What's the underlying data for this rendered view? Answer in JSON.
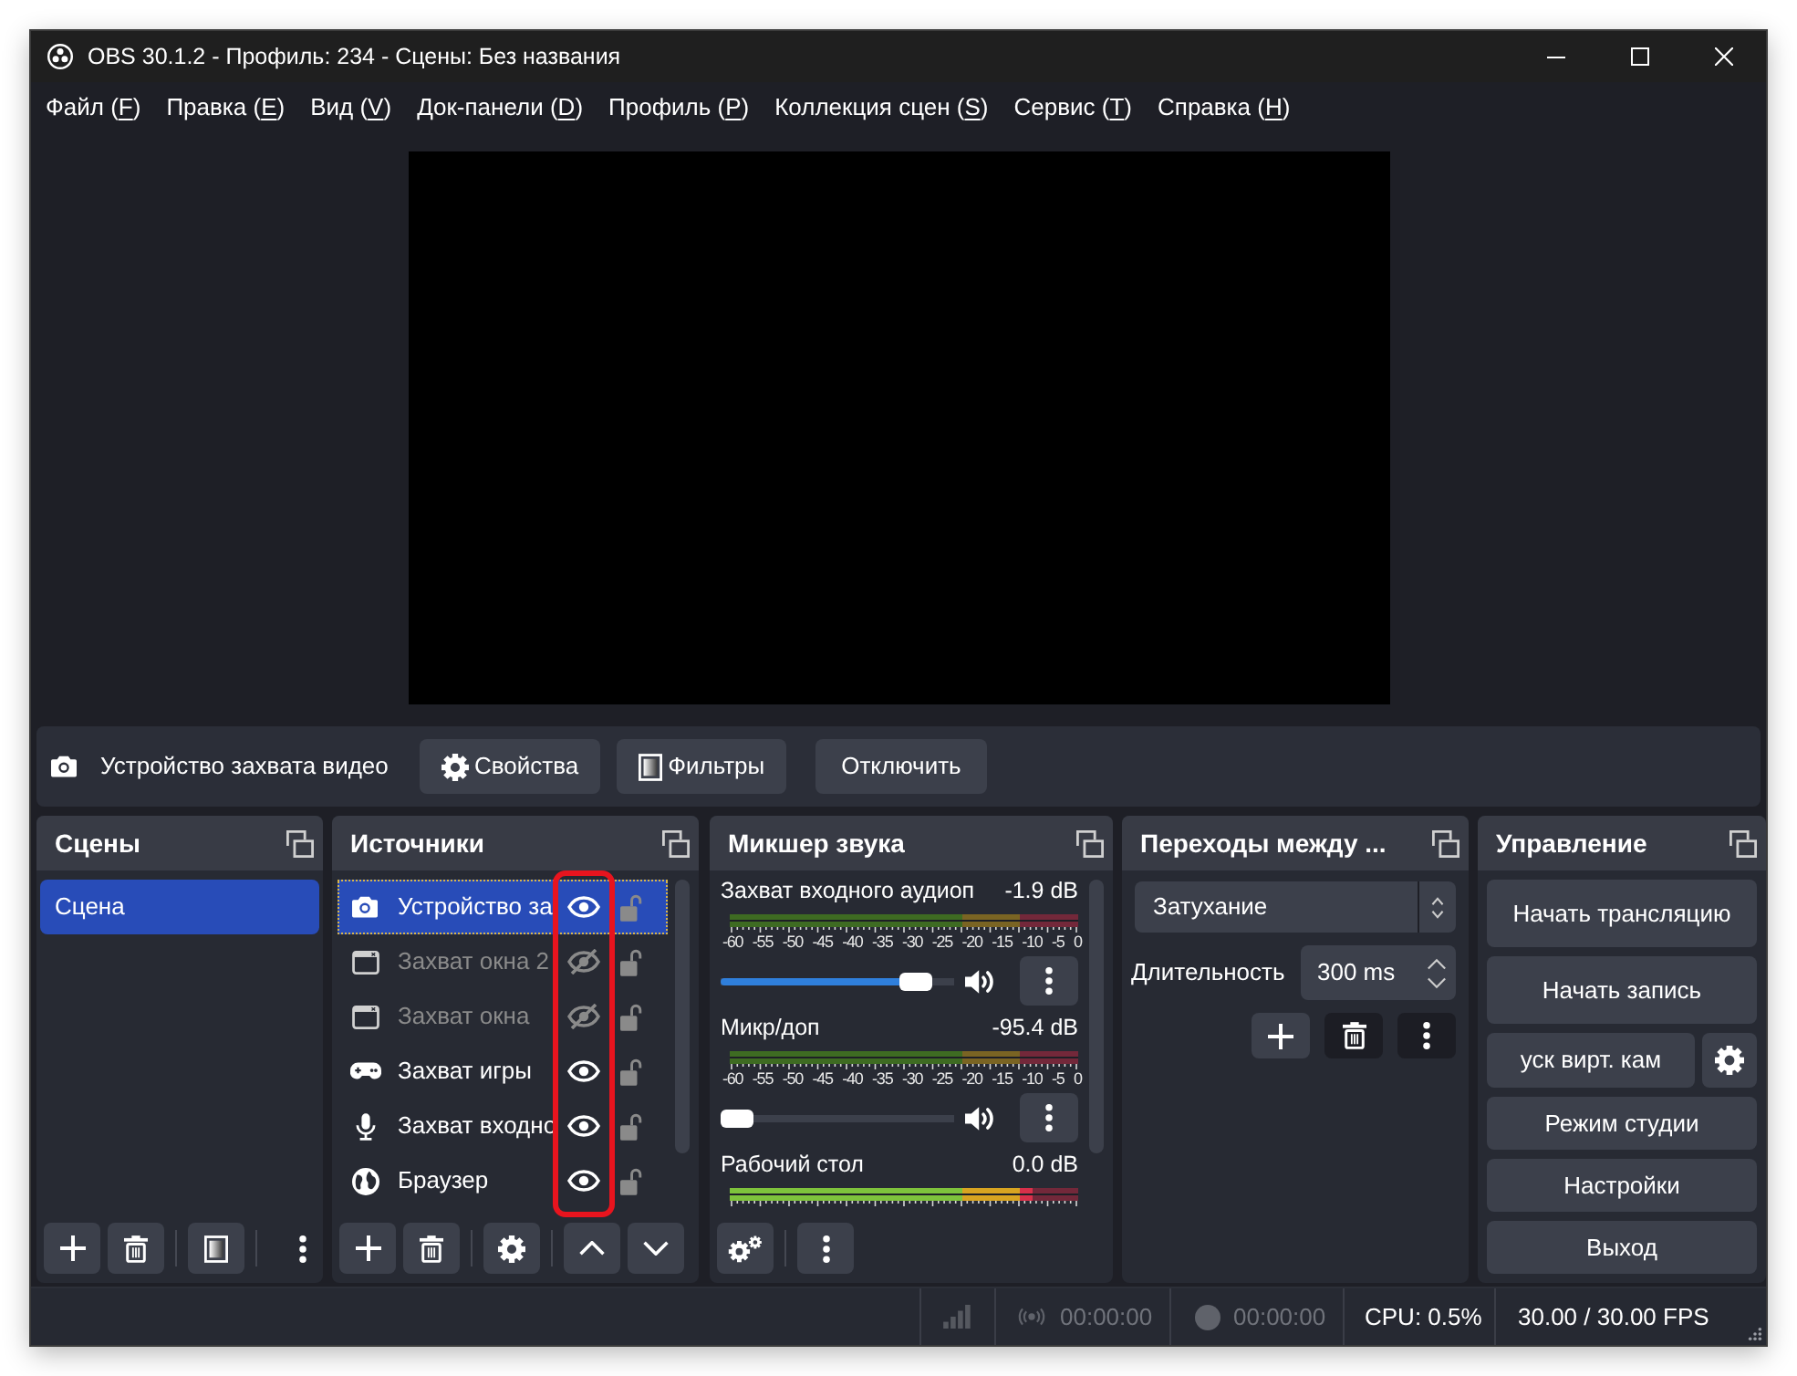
{
  "window": {
    "title": "OBS 30.1.2 - Профиль: 234 - Сцены: Без названия"
  },
  "menu": [
    {
      "text_before": "Файл (",
      "accel": "F",
      "text_after": ")"
    },
    {
      "text_before": "Правка (",
      "accel": "E",
      "text_after": ")"
    },
    {
      "text_before": "Вид (",
      "accel": "V",
      "text_after": ")"
    },
    {
      "text_before": "Док-панели (",
      "accel": "D",
      "text_after": ")"
    },
    {
      "text_before": "Профиль (",
      "accel": "P",
      "text_after": ")"
    },
    {
      "text_before": "Коллекция сцен (",
      "accel": "S",
      "text_after": ")"
    },
    {
      "text_before": "Сервис (",
      "accel": "T",
      "text_after": ")"
    },
    {
      "text_before": "Справка (",
      "accel": "H",
      "text_after": ")"
    }
  ],
  "source_toolbar": {
    "source": "Устройство захвата видео",
    "buttons": [
      {
        "kind": "properties",
        "label": "Свойства"
      },
      {
        "kind": "filters",
        "label": "Фильтры"
      },
      {
        "kind": "deactivate",
        "label": "Отключить"
      }
    ]
  },
  "scenes": {
    "title": "Сцены",
    "items": [
      {
        "label": "Сцена",
        "selected": true
      }
    ]
  },
  "sources": {
    "title": "Источники",
    "highlight_visibility": true,
    "items": [
      {
        "name": "Устройство за",
        "kind": "video_capture",
        "visible": true,
        "locked": false,
        "selected": true
      },
      {
        "name": "Захват окна 2",
        "kind": "window_capture",
        "visible": false,
        "locked": false,
        "selected": false
      },
      {
        "name": "Захват окна",
        "kind": "window_capture",
        "visible": false,
        "locked": false,
        "selected": false
      },
      {
        "name": "Захват игры",
        "kind": "game_capture",
        "visible": true,
        "locked": false,
        "selected": false
      },
      {
        "name": "Захват входно",
        "kind": "audio_input",
        "visible": true,
        "locked": false,
        "selected": false
      },
      {
        "name": "Браузер",
        "kind": "browser",
        "visible": true,
        "locked": false,
        "selected": false
      }
    ]
  },
  "mixer": {
    "title": "Микшер звука",
    "channels": [
      {
        "name": "Захват входного аудиоп",
        "reading": "-1.9 dB",
        "scale": [
          "-60",
          "-55",
          "-50",
          "-45",
          "-40",
          "-35",
          "-30",
          "-25",
          "-20",
          "-15",
          "-10",
          "-5",
          "0"
        ],
        "fader": {
          "level": 0.89
        },
        "muted": false
      },
      {
        "name": "Микр/доп",
        "reading": "-95.4 dB",
        "scale": [
          "-60",
          "-55",
          "-50",
          "-45",
          "-40",
          "-35",
          "-30",
          "-25",
          "-20",
          "-15",
          "-10",
          "-5",
          "0"
        ],
        "fader": {
          "level": 0
        },
        "muted": false
      },
      {
        "name": "Рабочий стол",
        "reading": "0.0 dB",
        "meter": {
          "level": 0.87
        }
      }
    ]
  },
  "transitions": {
    "title": "Переходы между ...",
    "transition": "Затухание",
    "duration_label": "Длительность",
    "duration": "300 ms",
    "buttons": [
      {
        "flat": false
      },
      {
        "flat": true
      },
      {
        "flat": true
      }
    ]
  },
  "controls": {
    "title": "Управление",
    "buttons": [
      {
        "kind": "stream",
        "label": "Начать трансляцию"
      },
      {
        "kind": "record",
        "label": "Начать запись"
      },
      {
        "kind": "vcam",
        "label": "уск вирт. кам"
      },
      {
        "kind": "studio",
        "label": "Режим студии"
      },
      {
        "kind": "settings",
        "label": "Настройки"
      },
      {
        "kind": "exit",
        "label": "Выход"
      }
    ]
  },
  "status_bar": {
    "streaming": false,
    "stream_time": "00:00:00",
    "recording": false,
    "record_time": "00:00:00",
    "cpu": "CPU: 0.5%",
    "fps": "30.00 / 30.00 FPS"
  }
}
